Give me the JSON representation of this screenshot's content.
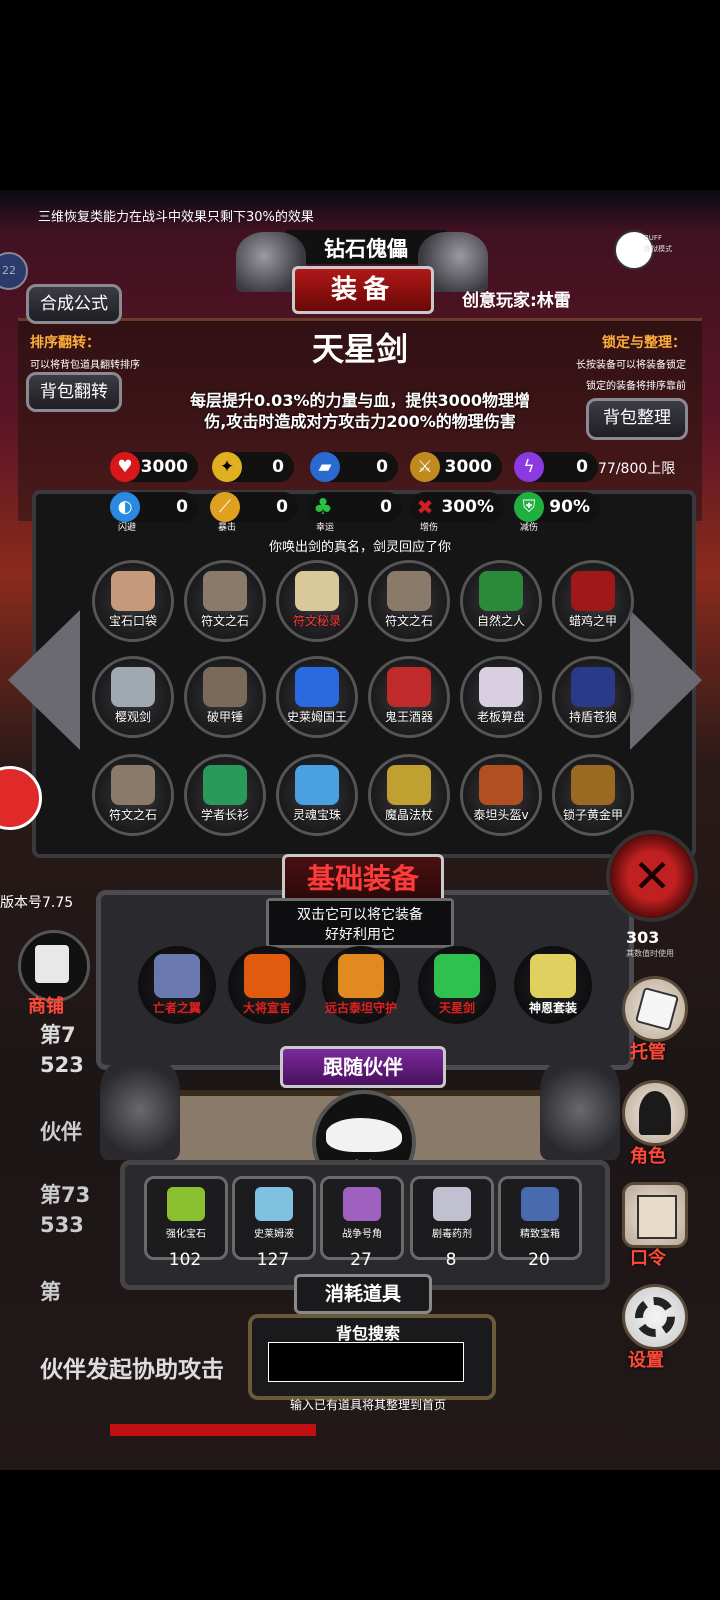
{
  "top_tip": "三维恢复类能力在战斗中效果只剩下30%的效果",
  "title_banner": "钻石傀儡",
  "equipment_tab": "装备",
  "player_name": "创意玩家:林雷",
  "mode_badge": {
    "top": "BUFF",
    "bottom": "炼狱模式"
  },
  "notif_count": "22",
  "left_buttons": {
    "craft": "合成公式",
    "flip": "背包翻转"
  },
  "sort_flip": {
    "title": "排序翻转：",
    "desc": "可以将背包道具翻转排序"
  },
  "lock_sort": {
    "title": "锁定与整理：",
    "desc1": "长按装备可以将装备锁定",
    "desc2": "锁定的装备将排序靠前"
  },
  "sort_button": "背包整理",
  "item": {
    "name": "天星剑",
    "desc_line1": "每层提升0.03%的力量与血，提供3000物理增",
    "desc_line2": "伤,攻击时造成对方攻击力200%的物理伤害",
    "flavor": "你唤出剑的真名，剑灵回应了你"
  },
  "capacity": "77/800上限",
  "stats_row1": [
    {
      "icon": "heart-icon",
      "value": "3000",
      "color": "#d81818"
    },
    {
      "icon": "strength-icon",
      "value": "0",
      "color": "#e0b020"
    },
    {
      "icon": "boot-icon",
      "value": "0",
      "color": "#2a6ad0"
    },
    {
      "icon": "sword-icon",
      "value": "3000",
      "color": "#c08a20"
    },
    {
      "icon": "lightning-icon",
      "value": "0",
      "color": "#8a3ae0"
    }
  ],
  "stats_row2": [
    {
      "icon": "dodge-icon",
      "value": "0",
      "sub": "闪避",
      "color": "#2a8ae0"
    },
    {
      "icon": "crit-icon",
      "value": "0",
      "sub": "暴击",
      "color": "#e0a020"
    },
    {
      "icon": "clover-icon",
      "value": "0",
      "sub": "幸运",
      "color": "#2ac040"
    },
    {
      "icon": "crossed-swords-icon",
      "value": "300%",
      "sub": "增伤",
      "color": "#d02020"
    },
    {
      "icon": "shield-icon",
      "value": "90%",
      "sub": "减伤",
      "color": "#20b040"
    }
  ],
  "inventory": [
    {
      "label": "宝石口袋",
      "color": "#c49a7a"
    },
    {
      "label": "符文之石",
      "color": "#8a7a6a"
    },
    {
      "label": "符文秘录",
      "color": "#d8c89a",
      "red": true
    },
    {
      "label": "符文之石",
      "color": "#8a7a6a"
    },
    {
      "label": "自然之人",
      "color": "#2a8a3a"
    },
    {
      "label": "蜡鸡之甲",
      "color": "#a01818"
    },
    {
      "label": "樱观剑",
      "color": "#a0a8b0"
    },
    {
      "label": "破甲锤",
      "color": "#7a6a5a"
    },
    {
      "label": "史莱姆国王",
      "color": "#2a6ae0"
    },
    {
      "label": "鬼王酒器",
      "color": "#c02a2a"
    },
    {
      "label": "老板算盘",
      "color": "#d8d0e0"
    },
    {
      "label": "持盾苍狼",
      "color": "#2a3a8a"
    },
    {
      "label": "符文之石",
      "color": "#8a7a6a"
    },
    {
      "label": "学者长衫",
      "color": "#2a9a5a"
    },
    {
      "label": "灵魂宝珠",
      "color": "#4aa0e0"
    },
    {
      "label": "魔晶法杖",
      "color": "#c0a030"
    },
    {
      "label": "泰坦头盔v",
      "color": "#b05020"
    },
    {
      "label": "锁子黄金甲",
      "color": "#9a6a20"
    }
  ],
  "basic_equip": {
    "title": "基础装备",
    "tip_line1": "双击它可以将它装备",
    "tip_line2": "好好利用它",
    "slots": [
      {
        "label": "亡者之翼",
        "color": "#e02020",
        "pic": "#6a7ab0"
      },
      {
        "label": "大将宣言",
        "color": "#e02020",
        "pic": "#e05a10"
      },
      {
        "label": "远古泰坦守护",
        "color": "#e02020",
        "pic": "#e08a20"
      },
      {
        "label": "天星剑",
        "color": "#e02020",
        "pic": "#30c050"
      },
      {
        "label": "神恩套装",
        "color": "#ffffff",
        "pic": "#e0d060"
      }
    ]
  },
  "hidden_side": {
    "stat": "303",
    "stat_sub": "其数值时使用"
  },
  "version": "版本号7.75",
  "shop": "商铺",
  "bg_lines": [
    {
      "a": "第7",
      "b": "523"
    },
    {
      "a": "伙伴",
      "b": ""
    },
    {
      "a": "第73",
      "b": "533"
    },
    {
      "a": "第",
      "b": ""
    }
  ],
  "bg_bottom": "伙伴发起协助攻击",
  "companion": {
    "title": "跟随伙伴",
    "name": "老白"
  },
  "consumables": {
    "title": "消耗道具",
    "items": [
      {
        "label": "强化宝石",
        "count": "102",
        "color": "#8ac030"
      },
      {
        "label": "史莱姆液",
        "count": "127",
        "color": "#80c0e0"
      },
      {
        "label": "战争号角",
        "count": "27",
        "color": "#a060c0"
      },
      {
        "label": "剧毒药剂",
        "count": "8",
        "color": "#c0c0d0"
      },
      {
        "label": "精致宝箱",
        "count": "20",
        "color": "#4a6ab0"
      }
    ]
  },
  "right_menu": [
    {
      "label": "托管",
      "icon": "dice-icon"
    },
    {
      "label": "角色",
      "icon": "hood-icon"
    },
    {
      "label": "口令",
      "icon": "scroll-icon"
    },
    {
      "label": "设置",
      "icon": "gear-icon"
    }
  ],
  "search": {
    "title": "背包搜索",
    "hint": "输入已有道具将其整理到首页",
    "value": ""
  }
}
